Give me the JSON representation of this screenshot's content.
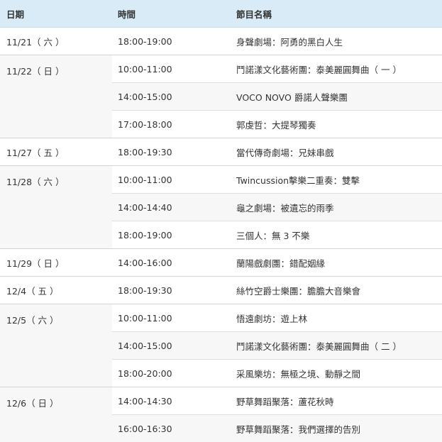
{
  "header": {
    "date": "日期",
    "time": "時間",
    "program": "節目名稱"
  },
  "rows": [
    {
      "date": "11/21（ 六 ）",
      "time": "18:00-19:00",
      "program": "身聲劇場：阿勇的黑白人生"
    },
    {
      "date": "11/22（ 日 ）",
      "time": "10:00-11:00",
      "program": "鬥諾漾文化藝術團：泰美麗圓舞曲（ 一 ）"
    },
    {
      "time": "14:00-15:00",
      "program": "VOCO NOVO 爵諾人聲樂團"
    },
    {
      "time": "17:00-18:00",
      "program": "郭虔哲：大提琴獨奏"
    },
    {
      "date": "11/27（ 五 ）",
      "time": "18:00-19:30",
      "program": "當代傳奇劇場：兄妹串戲"
    },
    {
      "date": "11/28（ 六 ）",
      "time": "10:00-11:00",
      "program": "Twincussion擊樂二重奏：雙擊"
    },
    {
      "time": "14:00-14:40",
      "program": "龜之劇場：被遺忘的雨季"
    },
    {
      "time": "18:00-19:00",
      "program": "三個人：無 3 不樂"
    },
    {
      "date": "11/29（ 日 ）",
      "time": "14:00-16:00",
      "program": "蘭陽戲劇團：錯配姻緣"
    },
    {
      "date": "12/4（ 五 ）",
      "time": "18:00-19:30",
      "program": "絲竹空爵士樂團：膽膽大音樂會"
    },
    {
      "date": "12/5（ 六 ）",
      "time": "10:00-11:00",
      "program": "悟遠劇坊：遊上林"
    },
    {
      "time": "14:00-15:00",
      "program": "鬥諾漾文化藝術團：泰美麗圓舞曲（ 二 ）"
    },
    {
      "time": "18:00-20:00",
      "program": "采風樂坊：無極之境、動靜之間"
    },
    {
      "date": "12/6（ 日 ）",
      "time": "14:00-14:30",
      "program": "野草舞蹈聚落：蘆花秋時"
    },
    {
      "time": "16:00-16:30",
      "program": "野草舞蹈聚落：我們選擇的告別"
    }
  ]
}
